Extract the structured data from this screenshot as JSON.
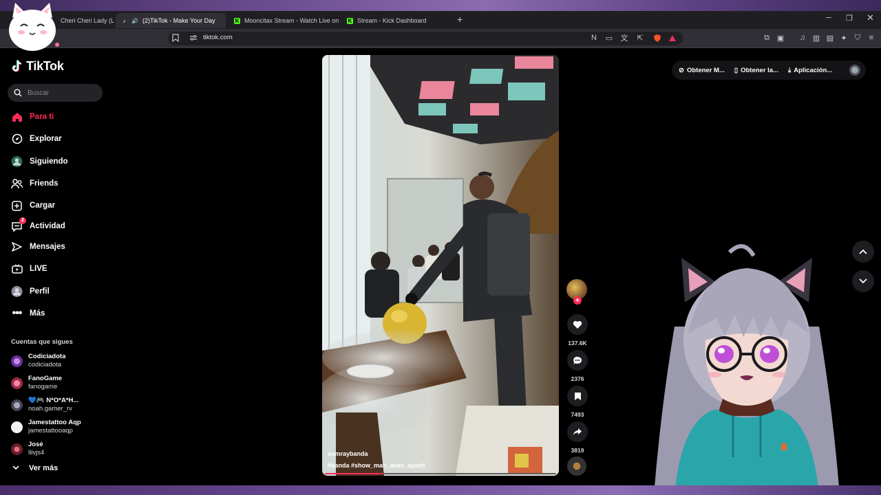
{
  "browser": {
    "tabs": [
      {
        "title": "Cheri Cheri Lady (L",
        "active": false
      },
      {
        "title": "(2)TikTok - Make Your Day",
        "active": true
      },
      {
        "title": "Mooncitax Stream - Watch Live on K",
        "active": false
      },
      {
        "title": "Stream - Kick Dashboard",
        "active": false
      }
    ],
    "address": "tiktok.com",
    "new_tab_icon": "plus-icon",
    "close_icon": "close-icon"
  },
  "tiktok": {
    "logo": "TikTok",
    "search_placeholder": "Buscar",
    "nav": [
      {
        "label": "Para ti",
        "icon": "home-icon",
        "active": true
      },
      {
        "label": "Explorar",
        "icon": "compass-icon"
      },
      {
        "label": "Siguiendo",
        "icon": "following-avatar"
      },
      {
        "label": "Friends",
        "icon": "friends-icon"
      },
      {
        "label": "Cargar",
        "icon": "upload-icon"
      },
      {
        "label": "Actividad",
        "icon": "activity-icon",
        "badge": "2"
      },
      {
        "label": "Mensajes",
        "icon": "send-icon"
      },
      {
        "label": "LIVE",
        "icon": "live-icon"
      },
      {
        "label": "Perfil",
        "icon": "profile-avatar"
      },
      {
        "label": "Más",
        "icon": "more-icon"
      }
    ],
    "following_title": "Cuentas que sigues",
    "following": [
      {
        "name": "Codiciadota",
        "handle": "codiciadota",
        "color": "#7b3fb5"
      },
      {
        "name": "FanoGame",
        "handle": "fanogame",
        "color": "#c23b54"
      },
      {
        "name": "💙🎮 N*O*A*H...",
        "handle": "noah.gamer_rv",
        "color": "#555a66"
      },
      {
        "name": "Jamestattoo Aqp",
        "handle": "jamestattooaqp",
        "color": "#e9e9e9"
      },
      {
        "name": "José",
        "handle": "llivjs4",
        "color": "#8a2f3a"
      }
    ],
    "see_more": "Ver más",
    "video": {
      "username": "sumraybanda",
      "hashtags": "#banda  #show_man_anas_ayash",
      "progress": 0.25
    },
    "actions": {
      "likes": "137.6K",
      "comments": "2376",
      "saves": "7493",
      "shares": "3819"
    },
    "header": {
      "btn1": "Obtener M...",
      "btn2": "Obtener la...",
      "btn3": "Aplicación..."
    }
  },
  "colors": {
    "accent": "#fe2c55",
    "kick": "#53fc18"
  }
}
